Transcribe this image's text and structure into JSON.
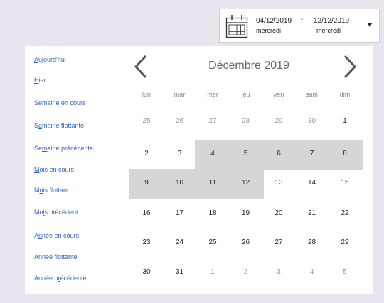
{
  "range": {
    "start_date": "04/12/2019",
    "start_weekday": "mercredi",
    "separator": "-",
    "end_date": "12/12/2019",
    "end_weekday": "mercredi"
  },
  "presets": [
    {
      "label": "Aujourd'hui",
      "ul": "A"
    },
    {
      "label": "Hier",
      "ul": "H"
    },
    {
      "label": "Semaine en cours",
      "ul": "S"
    },
    {
      "label": "Semaine flottante",
      "ul": "e"
    },
    {
      "label": "Semaine précédente",
      "ul": "m"
    },
    {
      "label": "Mois en cours",
      "ul": "M"
    },
    {
      "label": "Mois flottant",
      "ul": "o"
    },
    {
      "label": "Mois précédent",
      "ul": "i"
    },
    {
      "label": "Année en cours",
      "ul": "n"
    },
    {
      "label": "Année flottante",
      "ul": "é"
    },
    {
      "label": "Année précédente",
      "ul": "r"
    }
  ],
  "calendar": {
    "month_label": "Décembre 2019",
    "weekdays": [
      "lun",
      "mar",
      "mer",
      "jeu",
      "ven",
      "sam",
      "dim"
    ],
    "weeks": [
      [
        "25",
        "26",
        "27",
        "28",
        "29",
        "30",
        "1"
      ],
      [
        "2",
        "3",
        "4",
        "5",
        "6",
        "7",
        "8"
      ],
      [
        "9",
        "10",
        "11",
        "12",
        "13",
        "14",
        "15"
      ],
      [
        "16",
        "17",
        "18",
        "19",
        "20",
        "21",
        "22"
      ],
      [
        "23",
        "24",
        "25",
        "26",
        "27",
        "28",
        "29"
      ],
      [
        "30",
        "31",
        "1",
        "2",
        "3",
        "4",
        "5"
      ]
    ],
    "selected_range": {
      "start": "4",
      "end": "12"
    }
  },
  "colors": {
    "background": "#ebe3ee",
    "link": "#2f63c8",
    "highlight": "#d6d6d6"
  }
}
